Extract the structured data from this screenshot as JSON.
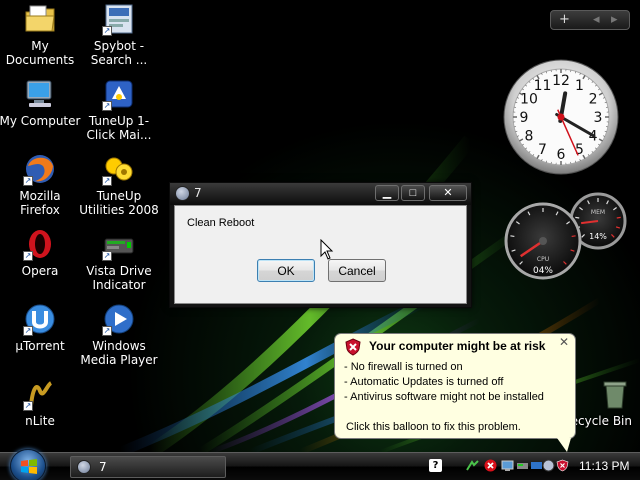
{
  "desktop": {
    "icons": [
      {
        "label": "My Documents",
        "icon": "my-documents-icon"
      },
      {
        "label": "Spybot - Search ...",
        "icon": "spybot-icon"
      },
      {
        "label": "My Computer",
        "icon": "my-computer-icon"
      },
      {
        "label": "TuneUp 1-Click Mai...",
        "icon": "tuneup-1click-icon"
      },
      {
        "label": "Mozilla Firefox",
        "icon": "firefox-icon"
      },
      {
        "label": "TuneUp Utilities 2008",
        "icon": "tuneup-utilities-icon"
      },
      {
        "label": "Opera",
        "icon": "opera-icon"
      },
      {
        "label": "Vista Drive Indicator",
        "icon": "vista-drive-indicator-icon"
      },
      {
        "label": "µTorrent",
        "icon": "utorrent-icon"
      },
      {
        "label": "Windows Media Player",
        "icon": "windows-media-player-icon"
      },
      {
        "label": "nLite",
        "icon": "nlite-icon"
      },
      {
        "label": "Recycle Bin",
        "icon": "recycle-bin-icon"
      }
    ]
  },
  "sidebar": {
    "add_glyph": "+",
    "prev_glyph": "◂",
    "next_glyph": "▸",
    "clock": {
      "hour": 12,
      "minute": 20,
      "second": 26,
      "labels": [
        "12",
        "1",
        "2",
        "3",
        "4",
        "5",
        "6",
        "7",
        "8",
        "9",
        "10",
        "11"
      ]
    },
    "cpu_meter": {
      "cpu_label": "CPU",
      "cpu_percent": "04%",
      "mem_label": "MEM",
      "mem_percent": "14%",
      "cpu_value": 4,
      "mem_value": 14
    }
  },
  "dialog": {
    "title": "7",
    "message": "Clean  Reboot",
    "ok_label": "OK",
    "cancel_label": "Cancel",
    "minimize_glyph": "▁",
    "maximize_glyph": "□",
    "close_glyph": "✕"
  },
  "balloon": {
    "title": "Your computer might be at risk",
    "lines": [
      "- No firewall is turned on",
      "- Automatic Updates is turned off",
      "- Antivirus software might not be installed"
    ],
    "footer": "Click this balloon to fix this problem.",
    "close_glyph": "✕"
  },
  "taskbar": {
    "task_label": "7",
    "clock": "11:13 PM",
    "tray_help_glyph": "?"
  },
  "colors": {
    "balloon_bg": "#ffffe1",
    "shield_red": "#c8102e",
    "taskbar_dark": "#151515"
  }
}
